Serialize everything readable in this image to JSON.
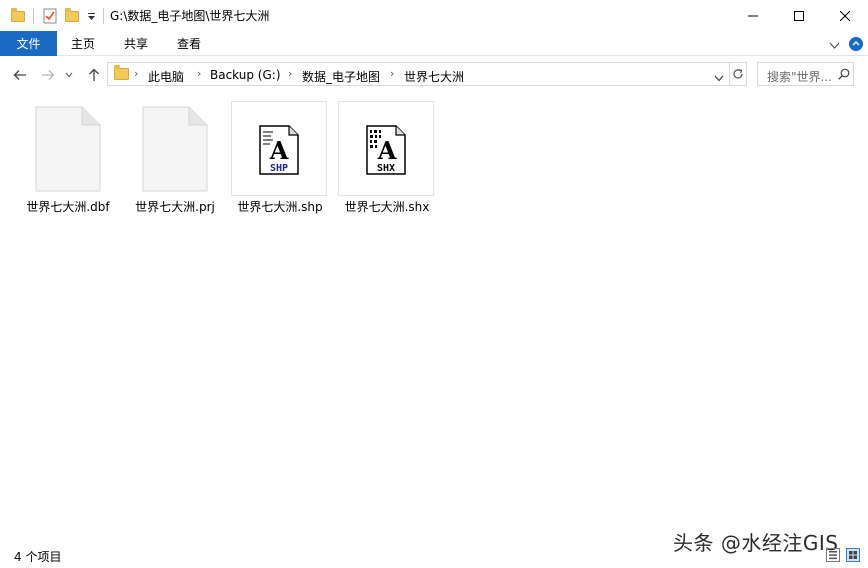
{
  "window": {
    "title": "G:\\数据_电子地图\\世界七大洲",
    "controls": {
      "minimize": "minimize-icon",
      "maximize": "maximize-icon",
      "close": "close-icon"
    }
  },
  "ribbon": {
    "tabs": [
      "文件",
      "主页",
      "共享",
      "查看"
    ],
    "accent": "#1a6ac4"
  },
  "nav": {
    "breadcrumb": [
      "此电脑",
      "Backup (G:)",
      "数据_电子地图",
      "世界七大洲"
    ],
    "search_placeholder": "搜索\"世界..."
  },
  "files": [
    {
      "name": "世界七大洲.dbf",
      "icon": "blank-file-icon"
    },
    {
      "name": "世界七大洲.prj",
      "icon": "blank-file-icon"
    },
    {
      "name": "世界七大洲.shp",
      "icon": "shp-file-icon",
      "badge": "SHP"
    },
    {
      "name": "世界七大洲.shx",
      "icon": "shx-file-icon",
      "badge": "SHX"
    }
  ],
  "status": {
    "item_count": "4 个项目"
  },
  "watermark": "头条 @水经注GIS"
}
